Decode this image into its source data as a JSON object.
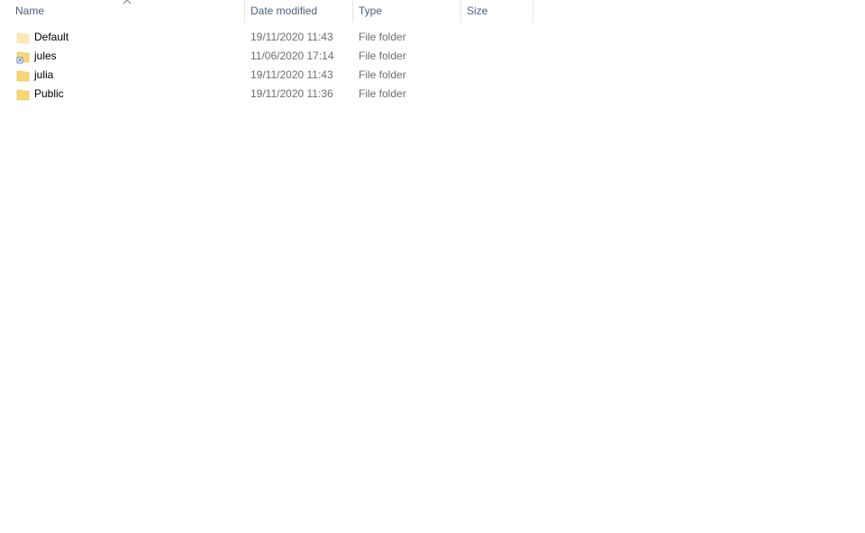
{
  "columns": {
    "name": "Name",
    "date_modified": "Date modified",
    "type": "Type",
    "size": "Size"
  },
  "sort": {
    "column": "name",
    "direction": "ascending",
    "icon": "chevron-up-icon"
  },
  "rows": [
    {
      "name": "Default",
      "date": "19/11/2020 11:43",
      "type": "File folder",
      "size": "",
      "icon": "folder-icon-faded"
    },
    {
      "name": "jules",
      "date": "11/06/2020 17:14",
      "type": "File folder",
      "size": "",
      "icon": "folder-shortcut-icon"
    },
    {
      "name": "julia",
      "date": "19/11/2020 11:43",
      "type": "File folder",
      "size": "",
      "icon": "folder-icon"
    },
    {
      "name": "Public",
      "date": "19/11/2020 11:36",
      "type": "File folder",
      "size": "",
      "icon": "folder-icon"
    }
  ],
  "colors": {
    "header_text": "#4c607a",
    "secondary_text": "#6d6d6d",
    "folder": "#f8d775",
    "folder_faded": "#fbe9b5"
  }
}
